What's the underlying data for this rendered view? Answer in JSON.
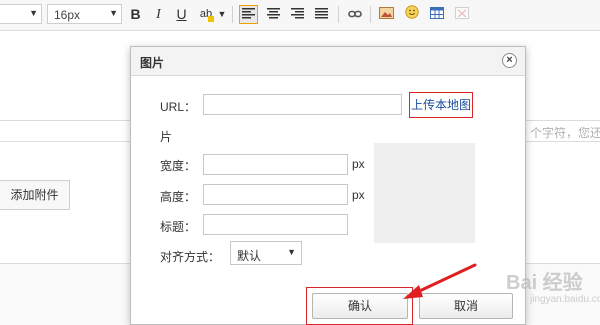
{
  "toolbar": {
    "font_family_value": "",
    "font_size_value": "16px",
    "bold_label": "B",
    "italic_label": "I",
    "underline_label": "U",
    "highlight_label": "ab"
  },
  "editor": {
    "char_count_text": "5 个字符，您还",
    "attach_button_label": "添加附件"
  },
  "dialog": {
    "title": "图片",
    "url_label": "URL：",
    "url_value": "",
    "upload_label": "上传本地图",
    "upload_label_wrap": "片",
    "width_label": "宽度：",
    "width_value": "",
    "width_unit": "px",
    "height_label": "高度：",
    "height_value": "",
    "height_unit": "px",
    "caption_label": "标题：",
    "caption_value": "",
    "align_label": "对齐方式：",
    "align_value": "默认",
    "confirm_label": "确认",
    "cancel_label": "取消"
  },
  "watermark": {
    "text": "Bai 经验",
    "sub": "jingyan.baidu.com"
  },
  "colors": {
    "highlight_border": "#d9262a",
    "arrow": "#e02020",
    "link": "#1a4e9c"
  }
}
